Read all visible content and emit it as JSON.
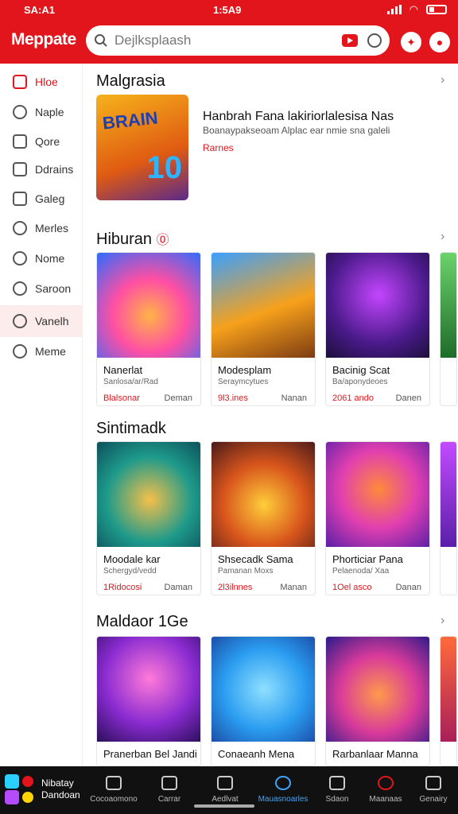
{
  "status": {
    "left": "SA:A1",
    "time": "1:5A9"
  },
  "header": {
    "logo": "Meppate",
    "search_placeholder": "Dejlksplaash"
  },
  "sidebar": {
    "items": [
      {
        "label": "Hloe",
        "icon": "home-icon"
      },
      {
        "label": "Naple",
        "icon": "compass-icon"
      },
      {
        "label": "Qore",
        "icon": "square-icon"
      },
      {
        "label": "Ddrains",
        "icon": "document-icon"
      },
      {
        "label": "Galeg",
        "icon": "gallery-icon"
      },
      {
        "label": "Merles",
        "icon": "chat-icon"
      },
      {
        "label": "Nome",
        "icon": "search-icon"
      },
      {
        "label": "Saroon",
        "icon": "bubble-icon"
      },
      {
        "label": "Vanelh",
        "icon": "disc-icon"
      },
      {
        "label": "Meme",
        "icon": "people-icon"
      }
    ]
  },
  "sections": [
    {
      "title": "Malgrasia"
    },
    {
      "title": "Hiburan"
    },
    {
      "title": "Sintimadk"
    },
    {
      "title": "Maldaor 1Ge"
    }
  ],
  "feature": {
    "art_text": "BRAIN",
    "art_num": "10",
    "title": "Hanbrah Fana lakiriorlalesisa Nas",
    "desc": "Boanaypakseoam Alplac ear nmie sna galeli",
    "tag": "Rarnes"
  },
  "row1": [
    {
      "name": "Nanerlat",
      "sub": "Sanlosa/ar/Rad",
      "price": "Blalsonar",
      "btn": "Deman"
    },
    {
      "name": "Modesplam",
      "sub": "Seraymcytues",
      "price": "9l3.ines",
      "btn": "Nanan"
    },
    {
      "name": "Bacinig Scat",
      "sub": "Ba/aponydeoes",
      "price": "2061 ando",
      "btn": "Danen"
    }
  ],
  "row2": [
    {
      "name": "Moodale kar",
      "sub": "Schergyd/vedd",
      "price": "1Ridocosi",
      "btn": "Daman"
    },
    {
      "name": "Shsecadk Sama",
      "sub": "Pamanan Moxs",
      "price": "2l3ilnnes",
      "btn": "Manan"
    },
    {
      "name": "Phorticiar Pana",
      "sub": "Pelaenoda/ Xaa",
      "price": "1Oel asco",
      "btn": "Danan"
    }
  ],
  "row3": [
    {
      "name": "Pranerban Bel Jandi"
    },
    {
      "name": "Conaeanh Mena"
    },
    {
      "name": "Rarbanlaar Manna"
    }
  ],
  "bottomnav": {
    "app_label1": "Nibatay",
    "app_label2": "Dandoan",
    "items": [
      "Cocoaomono",
      "Carrar",
      "Aedlvat",
      "Mauasnoarles",
      "Sdaon",
      "Maanaas",
      "Genairy"
    ]
  },
  "colors": {
    "brand_red": "#e1151b",
    "active_blue": "#3ba6ff"
  }
}
